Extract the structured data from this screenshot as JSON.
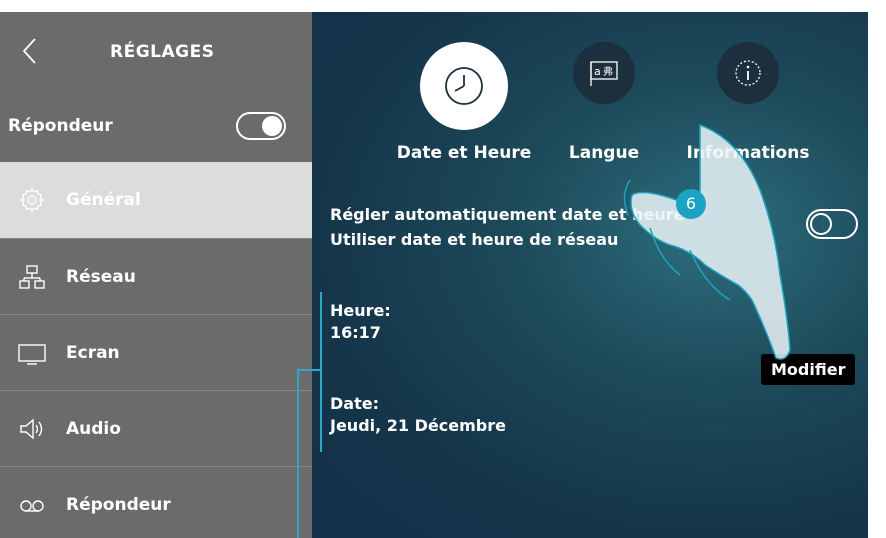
{
  "sidebar": {
    "title": "RÉGLAGES",
    "answering_machine_toggle": {
      "label": "Répondeur",
      "state": "on"
    },
    "items": [
      {
        "label": "Général",
        "icon": "gear-icon",
        "active": true
      },
      {
        "label": "Réseau",
        "icon": "network-icon",
        "active": false
      },
      {
        "label": "Ecran",
        "icon": "monitor-icon",
        "active": false
      },
      {
        "label": "Audio",
        "icon": "speaker-icon",
        "active": false
      },
      {
        "label": "Répondeur",
        "icon": "voicemail-icon",
        "active": false
      }
    ]
  },
  "tabs": [
    {
      "label": "Date et Heure",
      "icon": "clock-icon",
      "active": true
    },
    {
      "label": "Langue",
      "icon": "language-icon",
      "active": false
    },
    {
      "label": "Informations",
      "icon": "info-icon",
      "active": false
    }
  ],
  "main": {
    "auto_date_line1": "Régler automatiquement date et heure",
    "auto_date_line2": "Utiliser date et heure de réseau",
    "auto_date_toggle": "off",
    "time_label": "Heure:",
    "time_value": "16:17",
    "date_label": "Date:",
    "date_value": "Jeudi, 21 Décembre",
    "modify_label": "Modifier"
  },
  "annotation": {
    "step": "6"
  },
  "colors": {
    "sidebar_bg": "#6b6b6b",
    "active_item_bg": "#dcdcdc",
    "accent": "#1aa3c2",
    "main_bg": "#1d4a5a"
  }
}
